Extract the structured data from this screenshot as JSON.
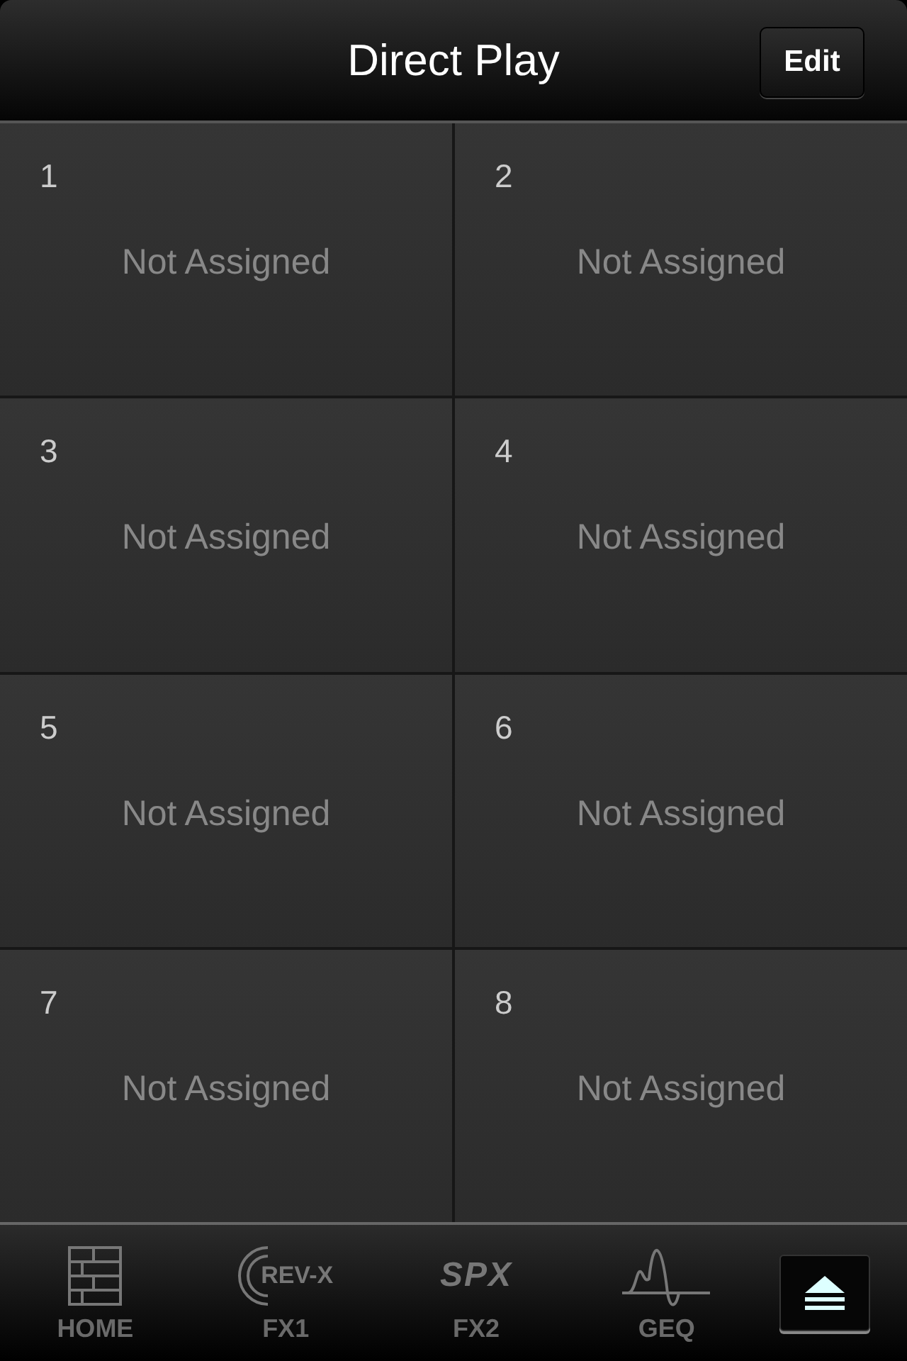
{
  "header": {
    "title": "Direct Play",
    "edit_button": "Edit"
  },
  "slots": [
    {
      "number": "1",
      "label": "Not Assigned"
    },
    {
      "number": "2",
      "label": "Not Assigned"
    },
    {
      "number": "3",
      "label": "Not Assigned"
    },
    {
      "number": "4",
      "label": "Not Assigned"
    },
    {
      "number": "5",
      "label": "Not Assigned"
    },
    {
      "number": "6",
      "label": "Not Assigned"
    },
    {
      "number": "7",
      "label": "Not Assigned"
    },
    {
      "number": "8",
      "label": "Not Assigned"
    }
  ],
  "tab_bar": [
    {
      "kind": "home",
      "label": "HOME",
      "selected": false
    },
    {
      "kind": "revx",
      "label": "FX1",
      "logo": "REV-X",
      "selected": false
    },
    {
      "kind": "spx",
      "label": "FX2",
      "logo": "SPX",
      "selected": false
    },
    {
      "kind": "geq",
      "label": "GEQ",
      "selected": false
    },
    {
      "kind": "eject",
      "selected": true
    }
  ]
}
